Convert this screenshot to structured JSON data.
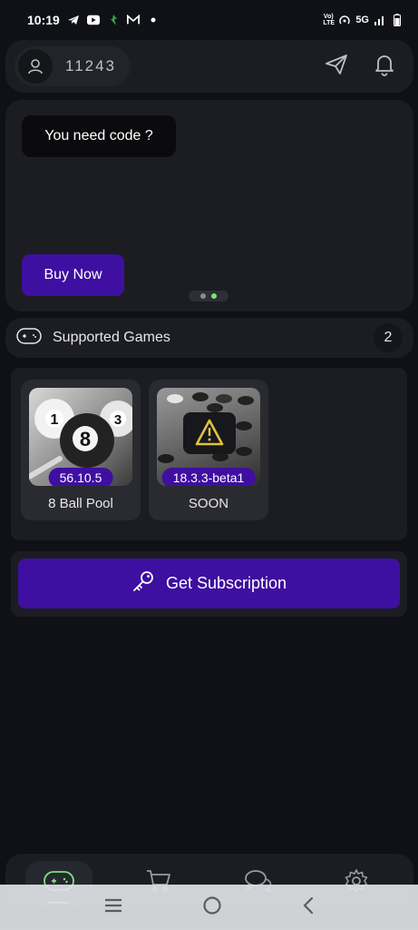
{
  "status_bar": {
    "time": "10:19",
    "network": "5G",
    "volte": "Vo) LTE"
  },
  "header": {
    "user_id": "11243",
    "icons": [
      "user-icon",
      "send-icon",
      "bell-icon"
    ]
  },
  "banner": {
    "tooltip_text": "You need code ?",
    "buy_label": "Buy Now",
    "slides": 2,
    "active_slide": 2
  },
  "games": {
    "title": "Supported Games",
    "count": "2",
    "items": [
      {
        "name": "8 Ball Pool",
        "version": "56.10.5",
        "icon": "billiard-balls-icon"
      },
      {
        "name": "SOON",
        "version": "18.3.3-beta1",
        "icon": "warning-icon"
      }
    ]
  },
  "subscription": {
    "label": "Get Subscription"
  },
  "bottom_nav": {
    "items": [
      "gamepad-icon",
      "cart-icon",
      "chat-icon",
      "gear-icon"
    ],
    "active_index": 0
  },
  "colors": {
    "background": "#0f1117",
    "card": "#1c1d22",
    "accent": "#3e0fa0",
    "active_green": "#7ee07e"
  }
}
